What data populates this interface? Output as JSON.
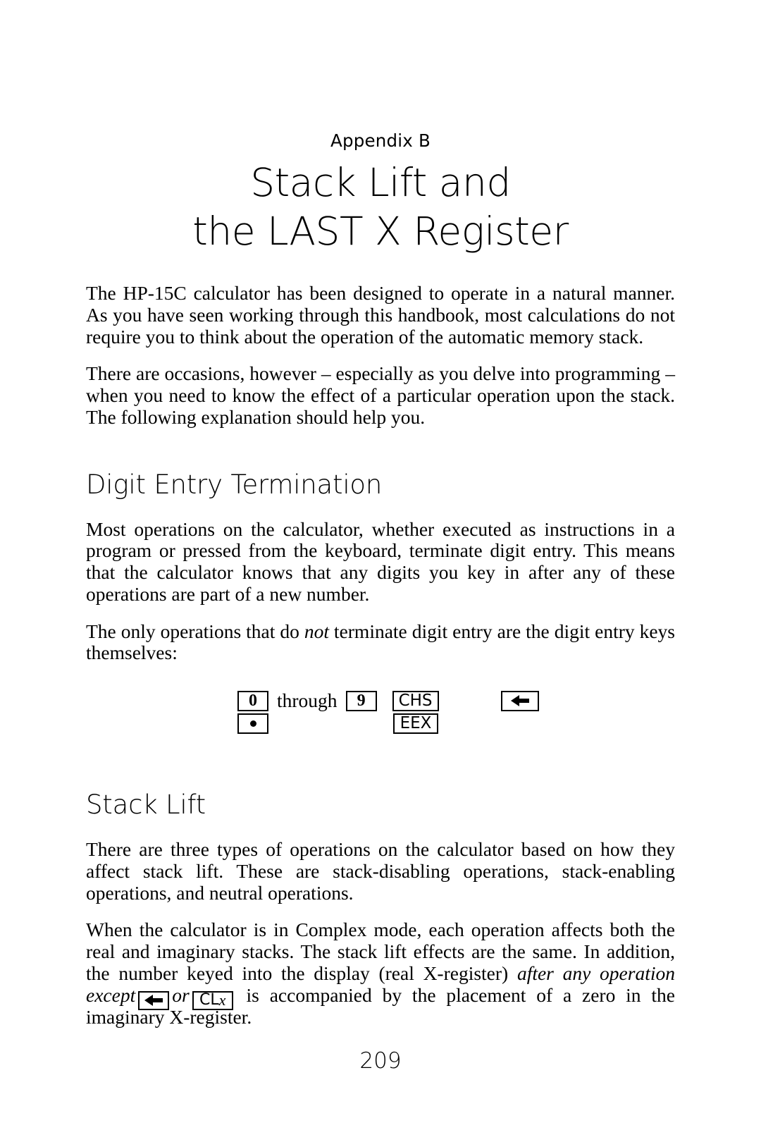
{
  "page": {
    "appendix_label": "Appendix B",
    "title_line_1": "Stack Lift and",
    "title_line_2": "the LAST X Register",
    "page_number": "209"
  },
  "intro": {
    "paragraph_1": "The HP-15C calculator has been designed to operate in a natural manner. As you have seen working through this handbook, most calculations do not require you to think about the operation of the automatic memory stack.",
    "paragraph_2": "There are occasions, however – especially as you delve into programming – when you need to know the effect of a particular operation upon the stack. The following explanation should help you."
  },
  "digit_entry_section": {
    "heading": "Digit Entry Termination",
    "paragraph_1": "Most operations on the calculator, whether executed as instructions in a program or pressed from the keyboard, terminate digit entry. This means that the calculator knows that any digits you key in after any of these operations are part of a new number.",
    "paragraph_2_before": "The only operations that do ",
    "paragraph_2_italic": "not",
    "paragraph_2_after": " terminate digit entry are the digit entry keys themselves:"
  },
  "key_diagram": {
    "row_1": {
      "key_zero": "0",
      "through_label": "through",
      "key_nine": "9",
      "key_chs": "CHS",
      "key_backspace_icon": "left-arrow-icon"
    },
    "row_2": {
      "key_decimal_point_icon": "dot-icon",
      "key_eex": "EEX"
    }
  },
  "stack_lift_section": {
    "heading": "Stack Lift",
    "paragraph_1": "There are three types of operations on the calculator based on how they affect stack lift. These are stack-disabling operations, stack-enabling operations, and neutral operations.",
    "paragraph_2": {
      "segment_1": "When the calculator is in Complex mode, each operation affects both the real and imaginary stacks. The stack lift effects are the same. In addition, the number keyed into the display (real X-register) ",
      "segment_2_italic": "after any operation except",
      "key_backspace_icon": "left-arrow-icon",
      "segment_3_italic": "or",
      "key_clx_prefix": "CL",
      "key_clx_suffix": "x",
      "segment_4": " is accompanied by the placement of a zero in the imaginary X-register."
    }
  }
}
